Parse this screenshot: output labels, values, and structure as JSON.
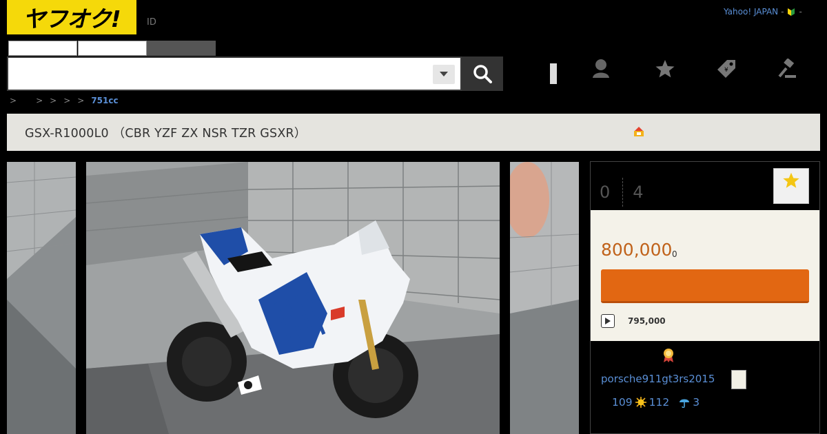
{
  "header": {
    "logo_text": "ヤフオク!",
    "id_link": "ID",
    "yahoo_japan": "Yahoo! JAPAN",
    "dash": "-"
  },
  "search": {
    "value": "",
    "placeholder": ""
  },
  "breadcrumb": {
    "sep1": ">",
    "sep2": ">",
    "sep3": ">",
    "sep4": ">",
    "sep5": ">",
    "current": "751cc"
  },
  "item": {
    "title": "GSX-R1000L0 （CBR YZF ZX NSR TZR GSXR）"
  },
  "auction": {
    "bids": "0",
    "remaining": "4",
    "current_price": "800,000",
    "price_suffix": "0",
    "bid_button_label": "",
    "buy_now_price": "795,000"
  },
  "seller": {
    "name": "porsche911gt3rs2015",
    "rating_total": "109",
    "rating_good": "112",
    "rating_bad": "3"
  },
  "colors": {
    "logo_bg": "#f5d90a",
    "price": "#c0621a",
    "bid_button": "#e26712",
    "link": "#5a8fd6"
  },
  "icons": {
    "search": "search-icon",
    "user": "user-icon",
    "star": "star-icon",
    "tag": "tag-icon",
    "gavel": "gavel-icon"
  }
}
